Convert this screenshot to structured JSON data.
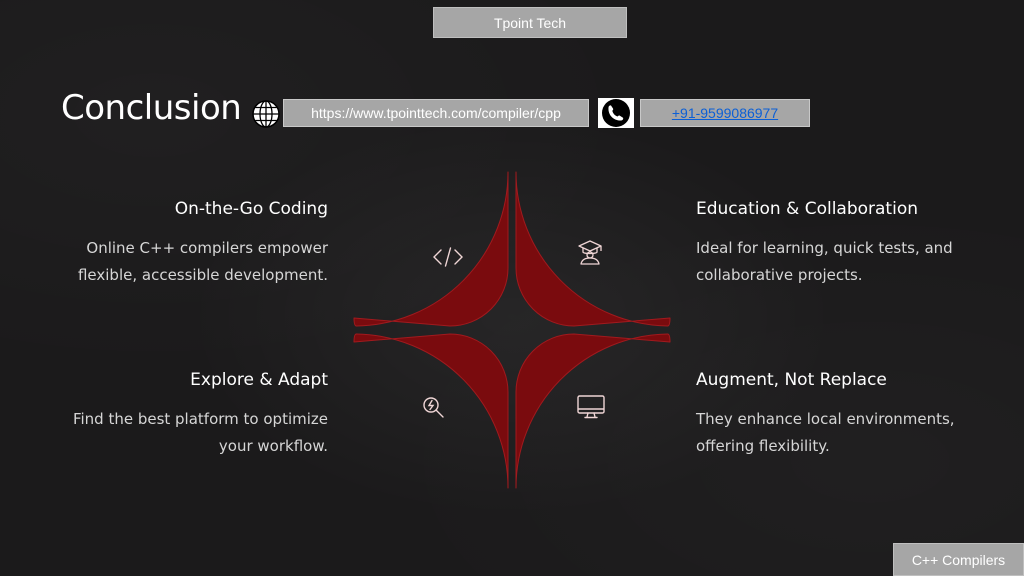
{
  "header": {
    "brand": "Tpoint Tech",
    "title": "Conclusion",
    "url": "https://www.tpointtech.com/compiler/cpp",
    "phone": "+91-9599086977"
  },
  "items": [
    {
      "title": "On-the-Go Coding",
      "desc_lines": [
        "Online C++ compilers empower",
        "flexible, accessible development."
      ],
      "icon": "code-icon"
    },
    {
      "title": "Education & Collaboration",
      "desc_lines": [
        "Ideal for learning, quick tests, and",
        "collaborative projects."
      ],
      "icon": "graduate-icon"
    },
    {
      "title": "Explore & Adapt",
      "desc_lines": [
        "Find the best platform to optimize",
        "your workflow."
      ],
      "icon": "search-bolt-icon"
    },
    {
      "title": "Augment, Not Replace",
      "desc_lines": [
        "They enhance local environments,",
        "offering flexibility."
      ],
      "icon": "monitor-icon"
    }
  ],
  "footer": {
    "label": "C++ Compilers"
  },
  "colors": {
    "segment": "#7a0b0e",
    "segment_border": "#a11a1e",
    "background": "#1b1a1b",
    "label_box": "#a6a6a6"
  }
}
